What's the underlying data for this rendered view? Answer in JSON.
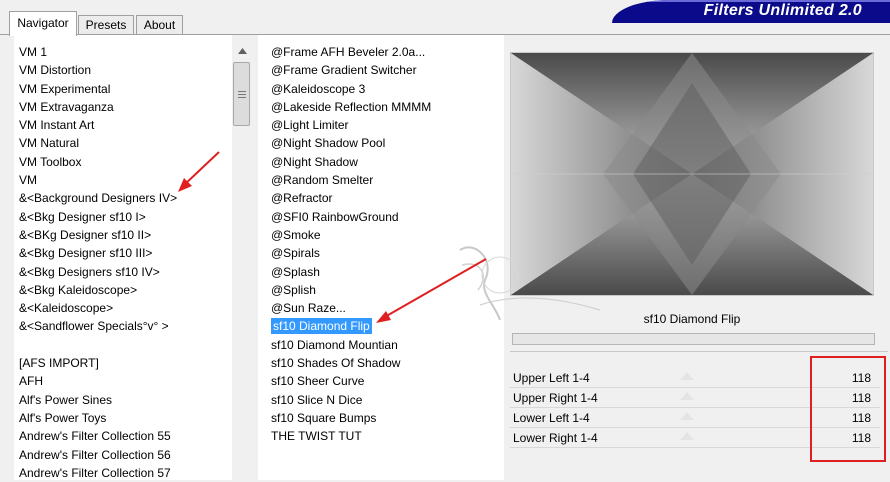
{
  "banner": {
    "title": "Filters Unlimited 2.0"
  },
  "tabs": [
    {
      "label": "Navigator",
      "active": true
    },
    {
      "label": "Presets",
      "active": false
    },
    {
      "label": "About",
      "active": false
    }
  ],
  "categories": [
    "VM 1",
    "VM Distortion",
    "VM Experimental",
    "VM Extravaganza",
    "VM Instant Art",
    "VM Natural",
    "VM Toolbox",
    "VM",
    "&<Background Designers IV>",
    "&<Bkg Designer sf10 I>",
    "&<BKg Designer sf10 II>",
    "&<Bkg Designer sf10 III>",
    "&<Bkg Designers sf10 IV>",
    "&<Bkg Kaleidoscope>",
    "&<Kaleidoscope>",
    "&<Sandflower Specials°v° >",
    "",
    "[AFS IMPORT]",
    "AFH",
    "Alf's Power Sines",
    "Alf's Power Toys",
    "Andrew's Filter Collection 55",
    "Andrew's Filter Collection 56",
    "Andrew's Filter Collection 57"
  ],
  "filters": {
    "items": [
      "@Frame AFH Beveler 2.0a...",
      "@Frame Gradient Switcher",
      "@Kaleidoscope 3",
      "@Lakeside Reflection MMMM",
      "@Light Limiter",
      "@Night Shadow Pool",
      "@Night Shadow",
      "@Random Smelter",
      "@Refractor",
      "@SFI0 RainbowGround",
      "@Smoke",
      "@Spirals",
      "@Splash",
      "@Splish",
      "@Sun Raze...",
      "sf10 Diamond Flip",
      "sf10 Diamond Mountian",
      "sf10 Shades Of Shadow",
      "sf10 Sheer Curve",
      "sf10 Slice N Dice",
      "sf10 Square Bumps",
      "THE TWIST TUT"
    ],
    "selected": "sf10 Diamond Flip"
  },
  "preview": {
    "filter_name": "sf10 Diamond Flip"
  },
  "params": [
    {
      "label": "Upper Left 1-4",
      "value": "118"
    },
    {
      "label": "Upper Right 1-4",
      "value": "118"
    },
    {
      "label": "Lower Left 1-4",
      "value": "118"
    },
    {
      "label": "Lower Right 1-4",
      "value": "118"
    }
  ],
  "colors": {
    "banner": "#0a0a8a",
    "selection": "#3399ff",
    "annotation": "#e02020"
  }
}
